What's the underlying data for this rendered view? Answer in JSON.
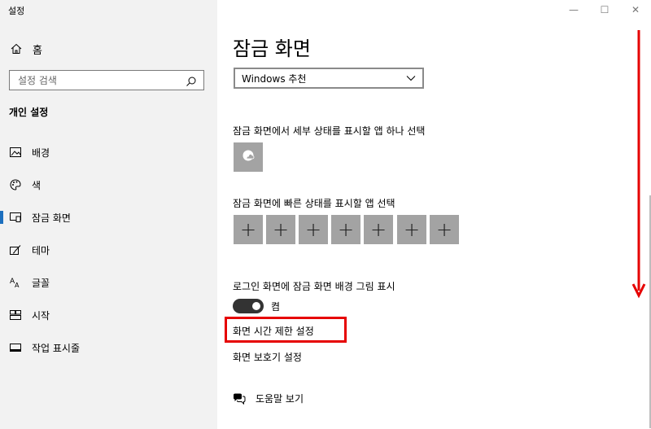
{
  "window": {
    "title": "설정",
    "minimize_glyph": "—",
    "maximize_glyph": "☐",
    "close_glyph": "✕"
  },
  "sidebar": {
    "home_label": "홈",
    "search_placeholder": "설정 검색",
    "section_title": "개인 설정",
    "items": [
      {
        "label": "배경",
        "icon": "picture-icon"
      },
      {
        "label": "색",
        "icon": "palette-icon"
      },
      {
        "label": "잠금 화면",
        "icon": "lock-screen-icon",
        "selected": true
      },
      {
        "label": "테마",
        "icon": "theme-icon"
      },
      {
        "label": "글꼴",
        "icon": "font-icon"
      },
      {
        "label": "시작",
        "icon": "start-icon"
      },
      {
        "label": "작업 표시줄",
        "icon": "taskbar-icon"
      }
    ]
  },
  "main": {
    "title": "잠금 화면",
    "background_dropdown_value": "Windows 추천",
    "detailed_status_label": "잠금 화면에서 세부 상태를 표시할 앱 하나 선택",
    "quick_status_label": "잠금 화면에 빠른 상태를 표시할 앱 선택",
    "quick_status_slots": [
      "+",
      "+",
      "+",
      "+",
      "+",
      "+",
      "+"
    ],
    "signin_background_label": "로그인 화면에 잠금 화면 배경 그림 표시",
    "toggle_state_label": "켬",
    "screen_timeout_link": "화면 시간 제한 설정",
    "screensaver_link": "화면 보호기 설정",
    "help_link": "도움말 보기"
  },
  "colors": {
    "annotation_red": "#e60000",
    "tile_gray": "#a3a3a3",
    "sidebar_bg": "#f2f2f2"
  }
}
